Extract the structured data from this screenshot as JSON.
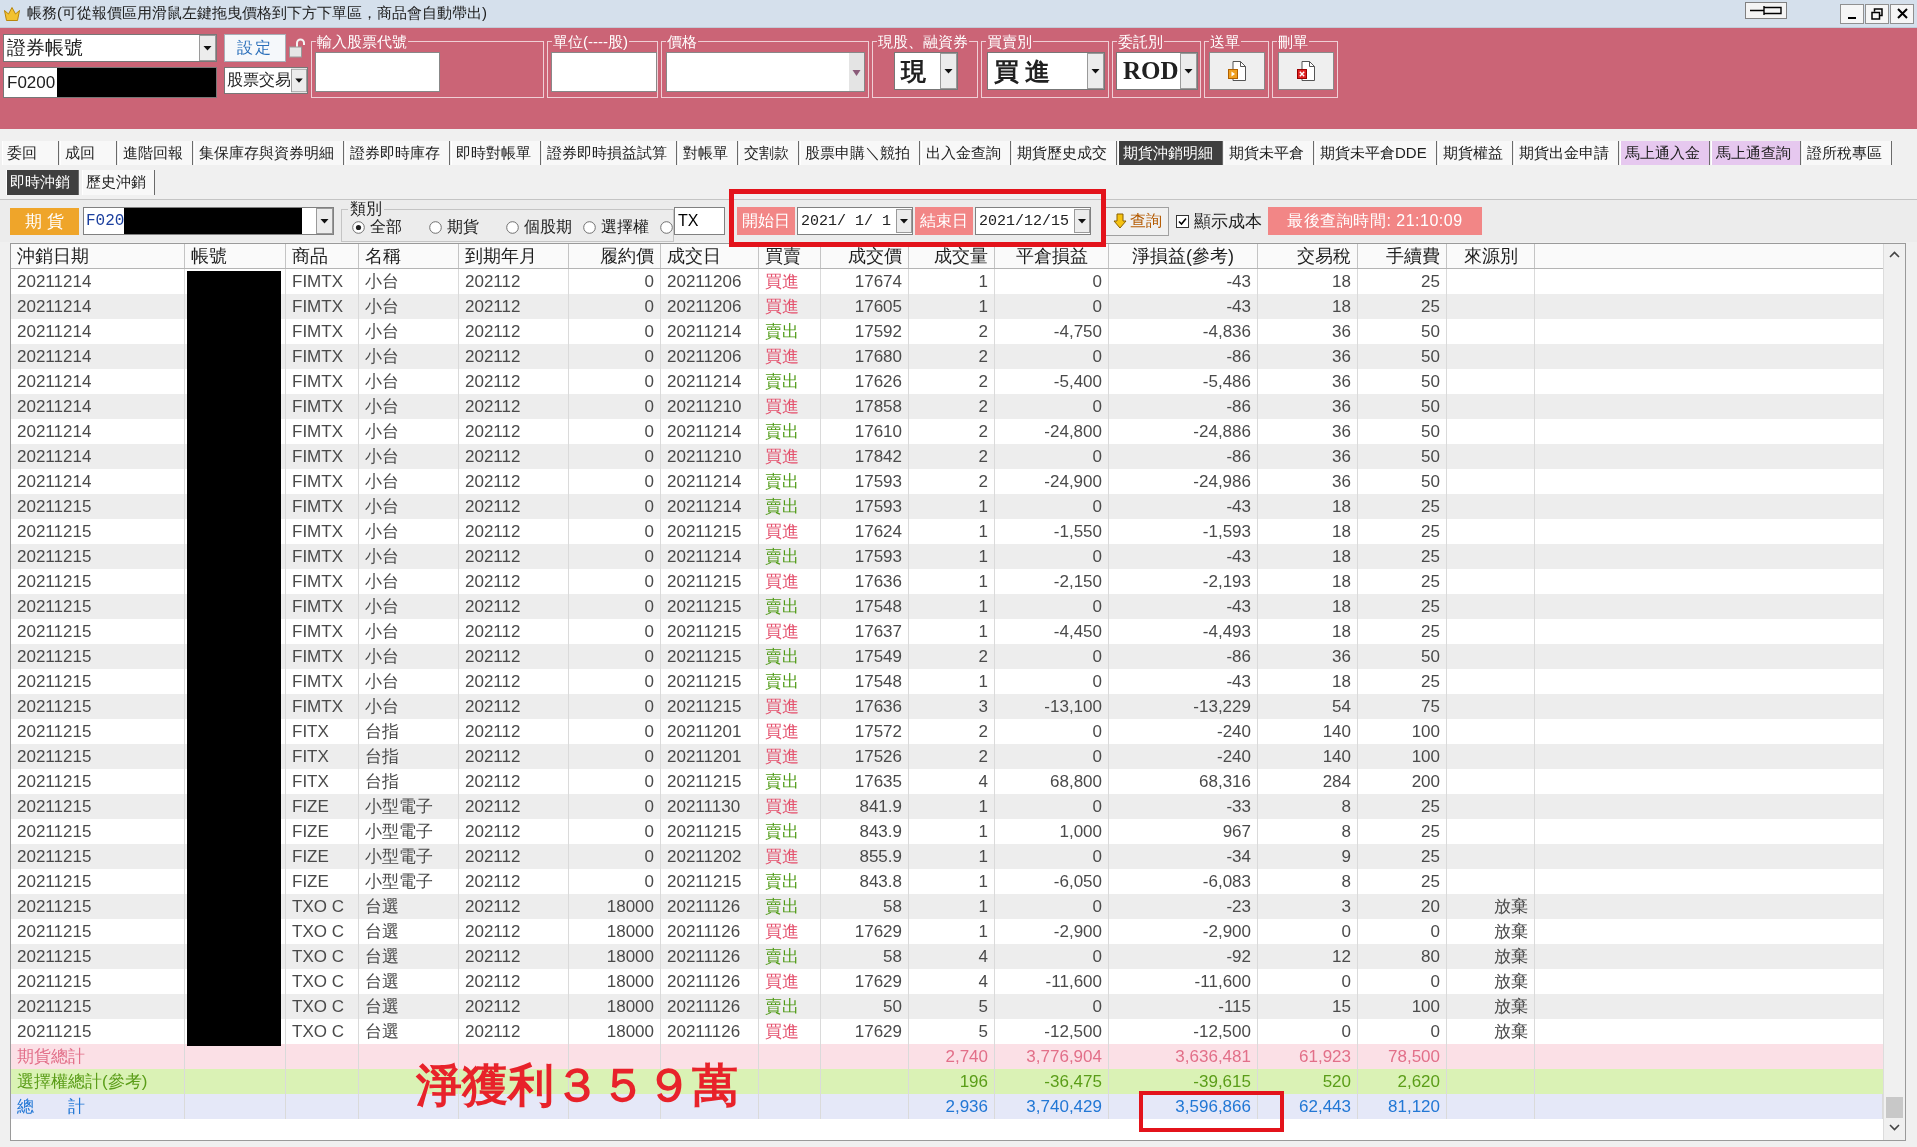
{
  "window": {
    "title": "帳務(可從報價區用滑鼠左鍵拖曳價格到下方下單區，商品會自動帶出)"
  },
  "order_bar": {
    "account_type": "證券帳號",
    "account": "F0200",
    "set_button": "設定",
    "trade_type": "股票交易",
    "groups": [
      {
        "kind": "input",
        "label": "輸入股票代號"
      },
      {
        "kind": "input",
        "label": "單位(----股)"
      },
      {
        "kind": "combo",
        "label": "價格"
      },
      {
        "kind": "select",
        "label": "現股、融資券",
        "value": "現"
      },
      {
        "kind": "select",
        "label": "買賣別",
        "value": "買 進"
      },
      {
        "kind": "select",
        "label": "委託別",
        "value": "ROD"
      },
      {
        "kind": "send",
        "label": "送單"
      },
      {
        "kind": "delete",
        "label": "刪單"
      }
    ]
  },
  "tabs": [
    {
      "label": "委回",
      "selected": false
    },
    {
      "label": "成回",
      "selected": false
    },
    {
      "label": "進階回報",
      "selected": false
    },
    {
      "label": "集保庫存與資券明細",
      "selected": false
    },
    {
      "label": "證券即時庫存",
      "selected": false
    },
    {
      "label": "即時對帳單",
      "selected": false
    },
    {
      "label": "證券即時損益試算",
      "selected": false
    },
    {
      "label": "對帳單",
      "selected": false
    },
    {
      "label": "交割款",
      "selected": false
    },
    {
      "label": "股票申購＼競拍",
      "selected": false
    },
    {
      "label": "出入金查詢",
      "selected": false
    },
    {
      "label": "期貨歷史成交",
      "selected": false
    },
    {
      "label": "期貨沖銷明細",
      "selected": true
    },
    {
      "label": "期貨未平倉",
      "selected": false
    },
    {
      "label": "期貨未平倉DDE",
      "selected": false
    },
    {
      "label": "期貨權益",
      "selected": false
    },
    {
      "label": "期貨出金申請",
      "selected": false
    },
    {
      "label": "馬上通入金",
      "selected": false,
      "color": "#e6c8ef"
    },
    {
      "label": "馬上通查詢",
      "selected": false,
      "color": "#e6c8ef"
    },
    {
      "label": "證所稅專區",
      "selected": false
    }
  ],
  "sub_tabs": [
    {
      "label": "即時沖銷",
      "selected": true
    },
    {
      "label": "歷史沖銷",
      "selected": false
    }
  ],
  "filter": {
    "market": "期 貨",
    "account": "F020",
    "category_label": "類別",
    "categories": [
      {
        "label": "全部",
        "selected": true
      },
      {
        "label": "期貨",
        "selected": false
      },
      {
        "label": "個股期",
        "selected": false
      },
      {
        "label": "選擇權",
        "selected": false
      }
    ],
    "symbol_option": {
      "selected": false,
      "value": "TX"
    },
    "date_range": {
      "boxed": true,
      "start_label": "開始日",
      "start_date": "2021/ 1/ 1",
      "end_label": "結束日",
      "end_date": "2021/12/15"
    },
    "query_button": "查詢",
    "show_cost": {
      "label": "顯示成本",
      "checked": true
    },
    "last_query": "最後查詢時間: 21:10:09"
  },
  "table": {
    "columns": [
      "沖銷日期",
      "帳號",
      "商品",
      "名稱",
      "到期年月",
      "履約價",
      "成交日",
      "買賣",
      "成交價",
      "成交量",
      "平倉損益",
      "淨損益(參考)",
      "交易稅",
      "手續費",
      "來源別"
    ],
    "rows": [
      {
        "kind": "buy",
        "cells": [
          "20211214",
          "",
          "FIMTX",
          "小台",
          "202112",
          "0",
          "20211206",
          "買進",
          "17674",
          "1",
          "0",
          "-43",
          "18",
          "25"
        ]
      },
      {
        "kind": "buy",
        "cells": [
          "20211214",
          "",
          "FIMTX",
          "小台",
          "202112",
          "0",
          "20211206",
          "買進",
          "17605",
          "1",
          "0",
          "-43",
          "18",
          "25"
        ]
      },
      {
        "kind": "sell",
        "cells": [
          "20211214",
          "",
          "FIMTX",
          "小台",
          "202112",
          "0",
          "20211214",
          "賣出",
          "17592",
          "2",
          "-4,750",
          "-4,836",
          "36",
          "50"
        ]
      },
      {
        "kind": "buy",
        "cells": [
          "20211214",
          "",
          "FIMTX",
          "小台",
          "202112",
          "0",
          "20211206",
          "買進",
          "17680",
          "2",
          "0",
          "-86",
          "36",
          "50"
        ]
      },
      {
        "kind": "sell",
        "cells": [
          "20211214",
          "",
          "FIMTX",
          "小台",
          "202112",
          "0",
          "20211214",
          "賣出",
          "17626",
          "2",
          "-5,400",
          "-5,486",
          "36",
          "50"
        ]
      },
      {
        "kind": "buy",
        "cells": [
          "20211214",
          "",
          "FIMTX",
          "小台",
          "202112",
          "0",
          "20211210",
          "買進",
          "17858",
          "2",
          "0",
          "-86",
          "36",
          "50"
        ]
      },
      {
        "kind": "sell",
        "cells": [
          "20211214",
          "",
          "FIMTX",
          "小台",
          "202112",
          "0",
          "20211214",
          "賣出",
          "17610",
          "2",
          "-24,800",
          "-24,886",
          "36",
          "50"
        ]
      },
      {
        "kind": "buy",
        "cells": [
          "20211214",
          "",
          "FIMTX",
          "小台",
          "202112",
          "0",
          "20211210",
          "買進",
          "17842",
          "2",
          "0",
          "-86",
          "36",
          "50"
        ]
      },
      {
        "kind": "sell",
        "cells": [
          "20211214",
          "",
          "FIMTX",
          "小台",
          "202112",
          "0",
          "20211214",
          "賣出",
          "17593",
          "2",
          "-24,900",
          "-24,986",
          "36",
          "50"
        ]
      },
      {
        "kind": "sell",
        "cells": [
          "20211215",
          "",
          "FIMTX",
          "小台",
          "202112",
          "0",
          "20211214",
          "賣出",
          "17593",
          "1",
          "0",
          "-43",
          "18",
          "25"
        ]
      },
      {
        "kind": "buy",
        "cells": [
          "20211215",
          "",
          "FIMTX",
          "小台",
          "202112",
          "0",
          "20211215",
          "買進",
          "17624",
          "1",
          "-1,550",
          "-1,593",
          "18",
          "25"
        ]
      },
      {
        "kind": "sell",
        "cells": [
          "20211215",
          "",
          "FIMTX",
          "小台",
          "202112",
          "0",
          "20211214",
          "賣出",
          "17593",
          "1",
          "0",
          "-43",
          "18",
          "25"
        ]
      },
      {
        "kind": "buy",
        "cells": [
          "20211215",
          "",
          "FIMTX",
          "小台",
          "202112",
          "0",
          "20211215",
          "買進",
          "17636",
          "1",
          "-2,150",
          "-2,193",
          "18",
          "25"
        ]
      },
      {
        "kind": "sell",
        "cells": [
          "20211215",
          "",
          "FIMTX",
          "小台",
          "202112",
          "0",
          "20211215",
          "賣出",
          "17548",
          "1",
          "0",
          "-43",
          "18",
          "25"
        ]
      },
      {
        "kind": "buy",
        "cells": [
          "20211215",
          "",
          "FIMTX",
          "小台",
          "202112",
          "0",
          "20211215",
          "買進",
          "17637",
          "1",
          "-4,450",
          "-4,493",
          "18",
          "25"
        ]
      },
      {
        "kind": "sell",
        "cells": [
          "20211215",
          "",
          "FIMTX",
          "小台",
          "202112",
          "0",
          "20211215",
          "賣出",
          "17549",
          "2",
          "0",
          "-86",
          "36",
          "50"
        ]
      },
      {
        "kind": "sell",
        "cells": [
          "20211215",
          "",
          "FIMTX",
          "小台",
          "202112",
          "0",
          "20211215",
          "賣出",
          "17548",
          "1",
          "0",
          "-43",
          "18",
          "25"
        ]
      },
      {
        "kind": "buy",
        "cells": [
          "20211215",
          "",
          "FIMTX",
          "小台",
          "202112",
          "0",
          "20211215",
          "買進",
          "17636",
          "3",
          "-13,100",
          "-13,229",
          "54",
          "75"
        ]
      },
      {
        "kind": "buy",
        "cells": [
          "20211215",
          "",
          "FITX",
          "台指",
          "202112",
          "0",
          "20211201",
          "買進",
          "17572",
          "2",
          "0",
          "-240",
          "140",
          "100"
        ]
      },
      {
        "kind": "buy",
        "cells": [
          "20211215",
          "",
          "FITX",
          "台指",
          "202112",
          "0",
          "20211201",
          "買進",
          "17526",
          "2",
          "0",
          "-240",
          "140",
          "100"
        ]
      },
      {
        "kind": "sell",
        "cells": [
          "20211215",
          "",
          "FITX",
          "台指",
          "202112",
          "0",
          "20211215",
          "賣出",
          "17635",
          "4",
          "68,800",
          "68,316",
          "284",
          "200"
        ]
      },
      {
        "kind": "buy",
        "cells": [
          "20211215",
          "",
          "FIZE",
          "小型電子",
          "202112",
          "0",
          "20211130",
          "買進",
          "841.9",
          "1",
          "0",
          "-33",
          "8",
          "25"
        ]
      },
      {
        "kind": "sell",
        "cells": [
          "20211215",
          "",
          "FIZE",
          "小型電子",
          "202112",
          "0",
          "20211215",
          "賣出",
          "843.9",
          "1",
          "1,000",
          "967",
          "8",
          "25"
        ]
      },
      {
        "kind": "buy",
        "cells": [
          "20211215",
          "",
          "FIZE",
          "小型電子",
          "202112",
          "0",
          "20211202",
          "買進",
          "855.9",
          "1",
          "0",
          "-34",
          "9",
          "25"
        ]
      },
      {
        "kind": "sell",
        "cells": [
          "20211215",
          "",
          "FIZE",
          "小型電子",
          "202112",
          "0",
          "20211215",
          "賣出",
          "843.8",
          "1",
          "-6,050",
          "-6,083",
          "8",
          "25"
        ]
      },
      {
        "kind": "sell",
        "cells": [
          "20211215",
          "",
          "TXO C",
          "台選",
          "202112",
          "18000",
          "20211126",
          "賣出",
          "58",
          "1",
          "0",
          "-23",
          "3",
          "20",
          "放棄"
        ]
      },
      {
        "kind": "buy",
        "cells": [
          "20211215",
          "",
          "TXO C",
          "台選",
          "202112",
          "18000",
          "20211126",
          "買進",
          "17629",
          "1",
          "-2,900",
          "-2,900",
          "0",
          "0",
          "放棄"
        ]
      },
      {
        "kind": "sell",
        "cells": [
          "20211215",
          "",
          "TXO C",
          "台選",
          "202112",
          "18000",
          "20211126",
          "賣出",
          "58",
          "4",
          "0",
          "-92",
          "12",
          "80",
          "放棄"
        ]
      },
      {
        "kind": "buy",
        "cells": [
          "20211215",
          "",
          "TXO C",
          "台選",
          "202112",
          "18000",
          "20211126",
          "買進",
          "17629",
          "4",
          "-11,600",
          "-11,600",
          "0",
          "0",
          "放棄"
        ]
      },
      {
        "kind": "sell",
        "cells": [
          "20211215",
          "",
          "TXO C",
          "台選",
          "202112",
          "18000",
          "20211126",
          "賣出",
          "50",
          "5",
          "0",
          "-115",
          "15",
          "100",
          "放棄"
        ]
      },
      {
        "kind": "buy",
        "cells": [
          "20211215",
          "",
          "TXO C",
          "台選",
          "202112",
          "18000",
          "20211126",
          "買進",
          "17629",
          "5",
          "-12,500",
          "-12,500",
          "0",
          "0",
          "放棄"
        ]
      }
    ],
    "totals": [
      {
        "kind": "futures",
        "cells": [
          "期貨總計",
          "",
          "",
          "",
          "",
          "",
          "",
          "",
          "",
          "2,740",
          "3,776,904",
          "3,636,481",
          "61,923",
          "78,500"
        ],
        "boxed": false
      },
      {
        "kind": "options",
        "cells": [
          "選擇權總計(參考)",
          "",
          "",
          "",
          "",
          "",
          "",
          "",
          "",
          "196",
          "-36,475",
          "-39,615",
          "520",
          "2,620"
        ],
        "boxed": false
      },
      {
        "kind": "grand",
        "cells": [
          "總　　計",
          "",
          "",
          "",
          "",
          "",
          "",
          "",
          "",
          "2,936",
          "3,740,429",
          "3,596,866",
          "62,443",
          "81,120"
        ],
        "boxed": true
      }
    ],
    "annotation": "淨獲利３５９萬"
  }
}
